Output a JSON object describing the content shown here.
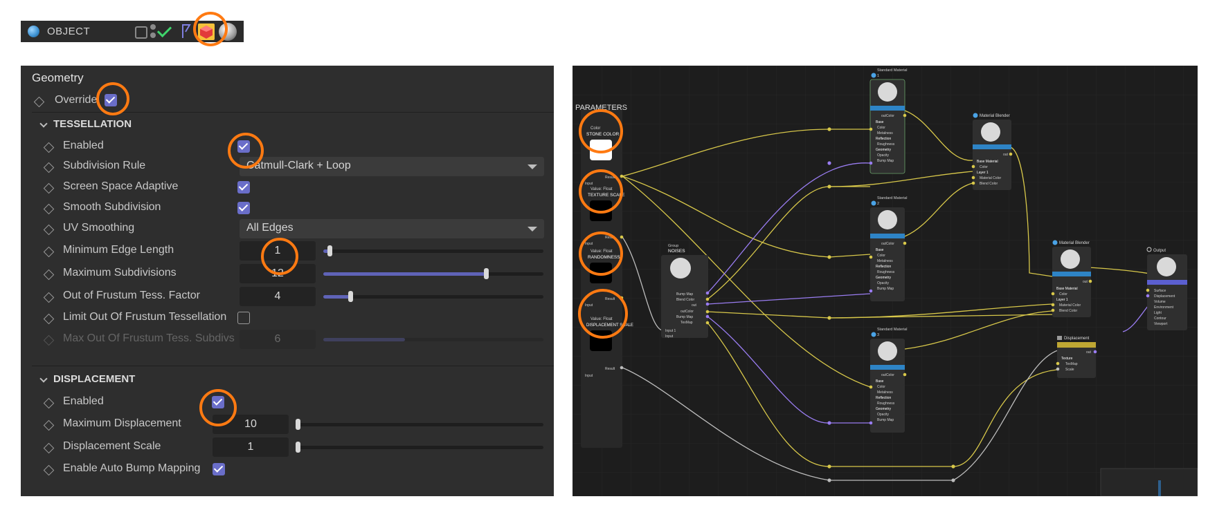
{
  "toolbar": {
    "title": "OBJECT",
    "icons": [
      "object-sphere-icon",
      "edit-icon",
      "dots-icon",
      "check-icon",
      "tag-icon",
      "material-cube-icon",
      "sphere-preview-icon"
    ],
    "accent": "#ff7a12"
  },
  "geometry_panel": {
    "header": "Geometry",
    "override_label": "Override",
    "override_checked": true,
    "tessellation": {
      "title": "TESSELLATION",
      "enabled_label": "Enabled",
      "enabled": true,
      "subdivision_rule_label": "Subdivision Rule",
      "subdivision_rule_value": "Catmull-Clark + Loop",
      "screen_space_label": "Screen Space Adaptive",
      "screen_space": true,
      "smooth_label": "Smooth Subdivision",
      "smooth": true,
      "uv_smoothing_label": "UV Smoothing",
      "uv_smoothing_value": "All Edges",
      "min_edge_label": "Minimum Edge Length",
      "min_edge_value": "1",
      "max_subdiv_label": "Maximum Subdivisions",
      "max_subdiv_value": "12",
      "frustum_factor_label": "Out of Frustum Tess. Factor",
      "frustum_factor_value": "4",
      "limit_frustum_label": "Limit Out Of Frustum Tessellation",
      "limit_frustum": false,
      "max_frustum_label": "Max Out Of Frustum Tess. Subdivs",
      "max_frustum_value": "6"
    },
    "displacement": {
      "title": "DISPLACEMENT",
      "enabled_label": "Enabled",
      "enabled": true,
      "max_disp_label": "Maximum Displacement",
      "max_disp_value": "10",
      "disp_scale_label": "Displacement Scale",
      "disp_scale_value": "1",
      "auto_bump_label": "Enable Auto Bump Mapping",
      "auto_bump": true
    }
  },
  "node_graph": {
    "parameters_title": "PARAMETERS",
    "params": [
      {
        "type": "Color",
        "name": "STONE COLOR"
      },
      {
        "type": "Value: Float",
        "name": "TEXTURE SCALE"
      },
      {
        "type": "Value: Float",
        "name": "RANDOMNESS"
      },
      {
        "type": "Value: Float",
        "name": "DISPLACEMENT SCALE"
      }
    ],
    "param_out": "Result",
    "param_in": "Input",
    "group": {
      "label": "Group",
      "name": "NOISES",
      "ports": [
        "Bump Map",
        "Blend Color",
        "out",
        "outColor",
        "Bump Map",
        "TexMap"
      ],
      "inputs": [
        "Input 1",
        "Input"
      ]
    },
    "standard_materials": [
      {
        "title": "Standard Material",
        "index": "1"
      },
      {
        "title": "Standard Material",
        "index": "2"
      },
      {
        "title": "Standard Material",
        "index": "3"
      }
    ],
    "std_ports": {
      "out": "outColor",
      "items": [
        "Base",
        "Color",
        "Metalness",
        "Reflection",
        "Roughness",
        "Geometry",
        "Opacity",
        "Bump Map"
      ]
    },
    "blenders": [
      {
        "title": "Material Blender",
        "out": "out",
        "items": [
          "Base Material",
          "Color",
          "Layer 1",
          "Material Color",
          "Blend Color"
        ]
      },
      {
        "title": "Material Blender",
        "out": "out",
        "items": [
          "Base Material",
          "Color",
          "Layer 1",
          "Material Color",
          "Blend Color"
        ]
      }
    ],
    "displacement_node": {
      "title": "Displacement",
      "out": "out",
      "items": [
        "Texture",
        "TexMap",
        "Scale"
      ]
    },
    "output_node": {
      "title": "Output",
      "items": [
        "Surface",
        "Displacement",
        "Volume",
        "Environment",
        "Light",
        "Contour",
        "Viewport"
      ]
    },
    "colors": {
      "yellow": "#d8c84a",
      "purple": "#9a7df2",
      "gray": "#bdbdbd",
      "blue": "#4aa3e6",
      "accent": "#ff7a12"
    }
  }
}
